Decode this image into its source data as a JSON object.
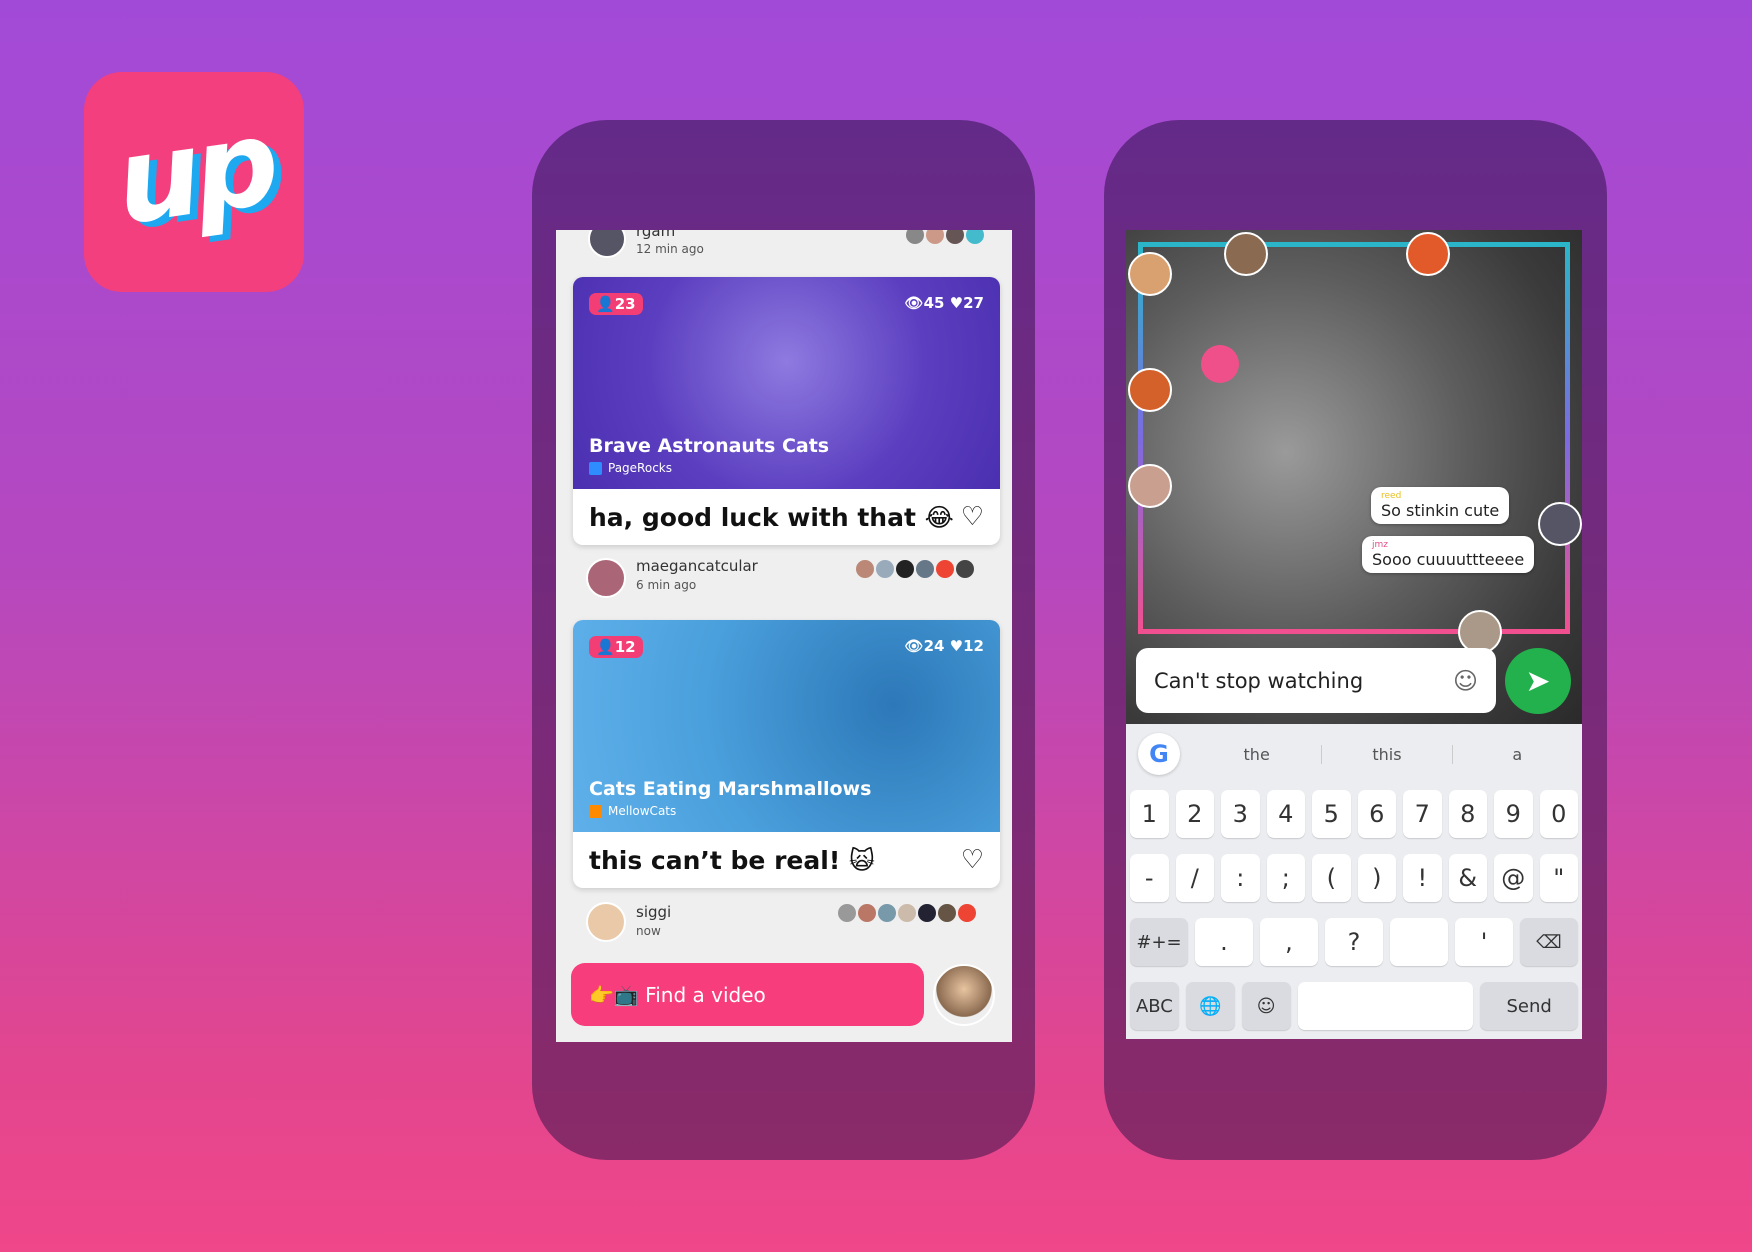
{
  "brand": {
    "logo_text": "up",
    "color": "#f33f7d",
    "accent": "#1ea8f0"
  },
  "feed": {
    "top_row": {
      "user": "rgam",
      "time": "12 min ago"
    },
    "cards": [
      {
        "viewers": "23",
        "views": "45",
        "likes": "27",
        "title": "Brave Astronauts Cats",
        "source": "PageRocks",
        "source_color": "#2f8cff",
        "caption": "ha, good luck with that 😂",
        "user": "maegancatcular",
        "time": "6 min ago"
      },
      {
        "viewers": "12",
        "views": "24",
        "likes": "12",
        "title": "Cats Eating Marshmallows",
        "source": "MellowCats",
        "source_color": "#ff8a00",
        "caption": "this can’t be real! 🙀",
        "user": "siggi",
        "time": "now"
      }
    ],
    "find_button": "👉📺 Find a video"
  },
  "chat": {
    "messages": [
      {
        "user": "reed",
        "text": "So stinkin cute",
        "user_color": "#e8c020"
      },
      {
        "user": "jmz",
        "text": "Sooo cuuuuttteeee",
        "user_color": "#e0508a"
      }
    ],
    "input_value": "Can't stop watching",
    "suggestions": [
      "the",
      "this",
      "a"
    ],
    "keys": {
      "row1": [
        "1",
        "2",
        "3",
        "4",
        "5",
        "6",
        "7",
        "8",
        "9",
        "0"
      ],
      "row2": [
        "-",
        "/",
        ":",
        ";",
        "(",
        ")",
        "!",
        "&",
        "@",
        "\""
      ],
      "row3": [
        "#+=",
        ".",
        ",",
        "?",
        "",
        "'",
        "⌫"
      ],
      "row4": [
        "ABC",
        "🌐",
        "☺",
        "",
        "Send"
      ]
    }
  }
}
